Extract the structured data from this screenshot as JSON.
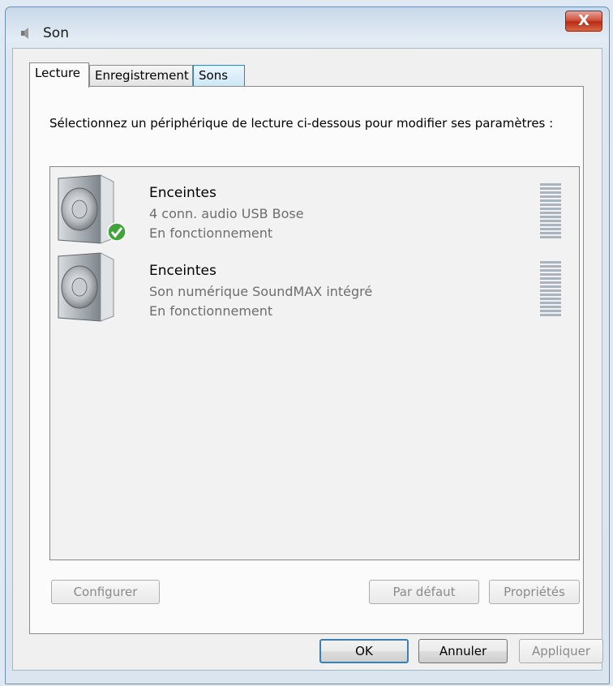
{
  "window": {
    "title": "Son",
    "close_glyph": "X"
  },
  "tabs": [
    {
      "label": "Lecture",
      "active": true
    },
    {
      "label": "Enregistrement",
      "active": false
    },
    {
      "label": "Sons",
      "active": false
    }
  ],
  "instruction": "Sélectionnez un périphérique de lecture ci-dessous pour modifier ses paramètres :",
  "devices": [
    {
      "name": "Enceintes",
      "description": "4 conn. audio USB Bose",
      "status": "En fonctionnement",
      "default": true,
      "icon": "speaker-icon"
    },
    {
      "name": "Enceintes",
      "description": "Son numérique SoundMAX intégré",
      "status": "En fonctionnement",
      "default": false,
      "icon": "speaker-icon"
    }
  ],
  "panel_buttons": {
    "configure": "Configurer",
    "set_default": "Par défaut",
    "properties": "Propriétés"
  },
  "dialog_buttons": {
    "ok": "OK",
    "cancel": "Annuler",
    "apply": "Appliquer"
  },
  "colors": {
    "accent": "#3c7fb1",
    "close": "#c8361d",
    "check": "#3fa53a"
  }
}
